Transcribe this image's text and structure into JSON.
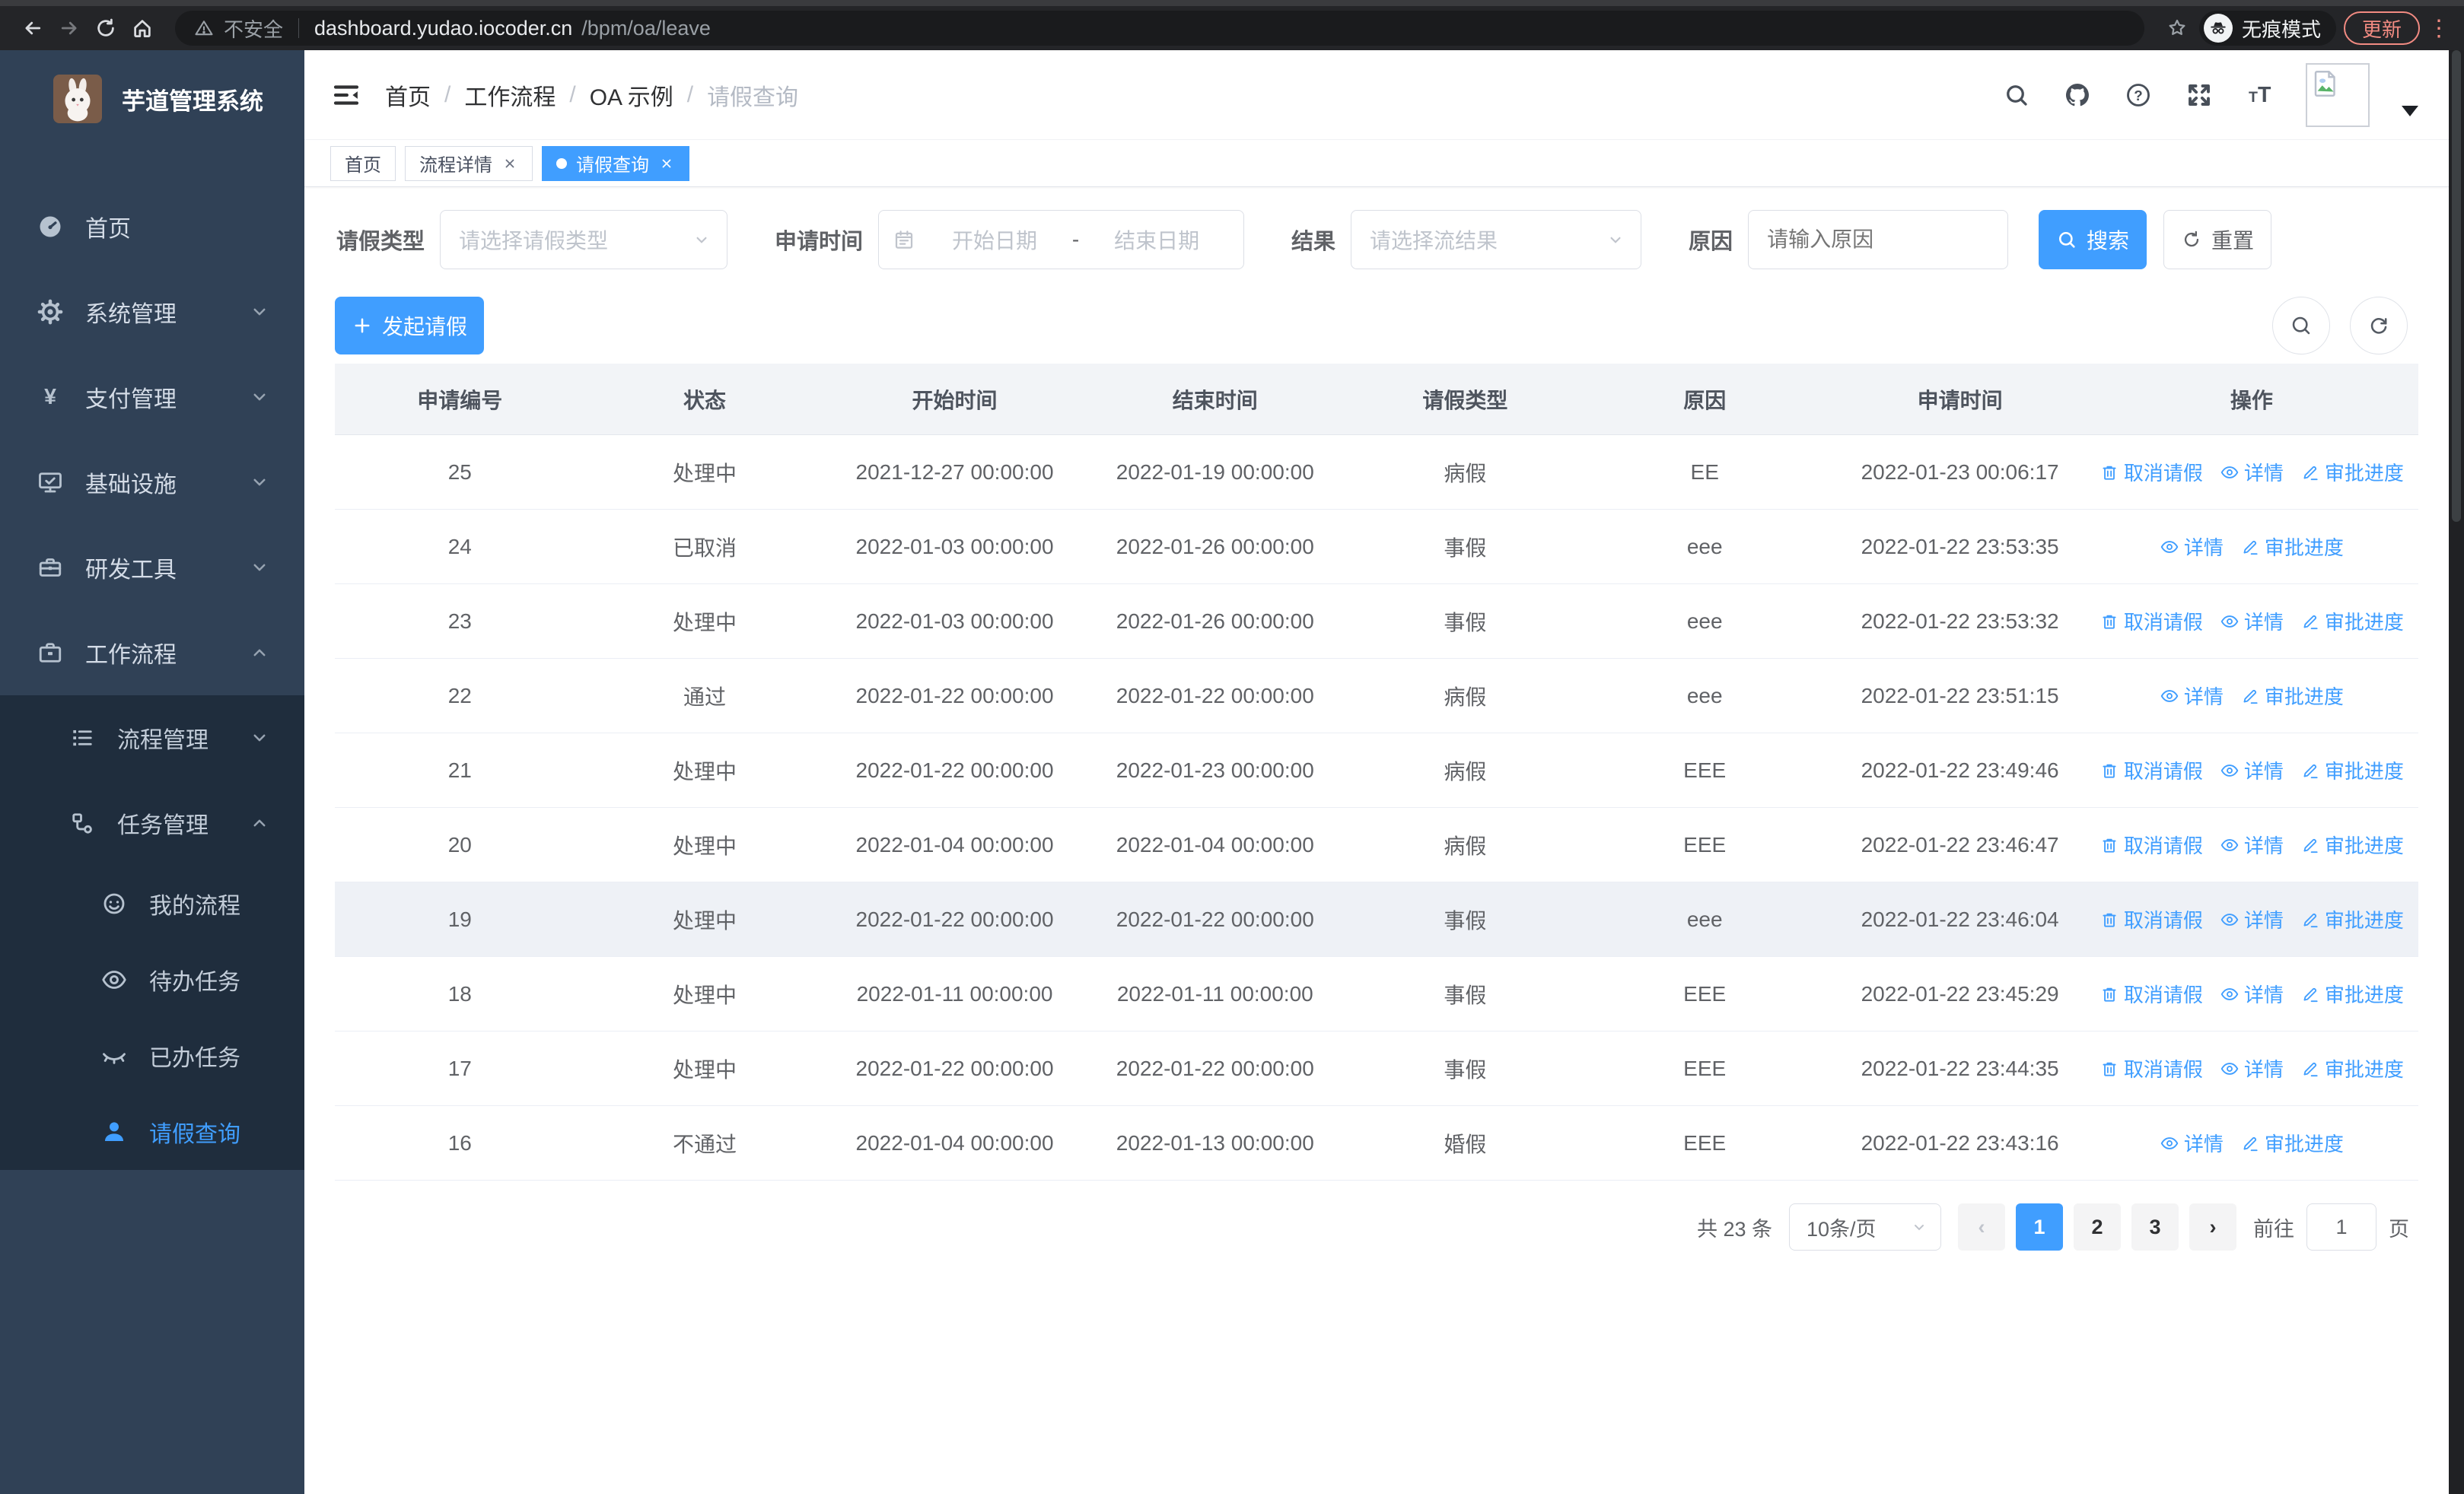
{
  "browser": {
    "security_label": "不安全",
    "url_host": "dashboard.yudao.iocoder.cn",
    "url_path": "/bpm/oa/leave",
    "incognito_label": "无痕模式",
    "update_label": "更新"
  },
  "sidebar": {
    "logo_title": "芋道管理系统",
    "menu": [
      {
        "key": "home",
        "label": "首页",
        "icon": "gauge-icon",
        "level": 1
      },
      {
        "key": "system",
        "label": "系统管理",
        "icon": "gear-icon",
        "level": 1,
        "chevron": "down"
      },
      {
        "key": "payment",
        "label": "支付管理",
        "icon": "yen-icon",
        "level": 1,
        "chevron": "down"
      },
      {
        "key": "infrastructure",
        "label": "基础设施",
        "icon": "monitor-icon",
        "level": 1,
        "chevron": "down"
      },
      {
        "key": "dev-tools",
        "label": "研发工具",
        "icon": "toolbox-icon",
        "level": 1,
        "chevron": "down"
      },
      {
        "key": "workflow",
        "label": "工作流程",
        "icon": "briefcase-icon",
        "level": 1,
        "chevron": "up"
      },
      {
        "key": "process-mgmt",
        "label": "流程管理",
        "icon": "flow-icon",
        "level": 2,
        "submenu": true,
        "chevron": "down"
      },
      {
        "key": "task-mgmt",
        "label": "任务管理",
        "icon": "tasks-icon",
        "level": 2,
        "submenu": true,
        "chevron": "up"
      },
      {
        "key": "my-process",
        "label": "我的流程",
        "icon": "face-icon",
        "level": 3,
        "submenu": true
      },
      {
        "key": "todo-tasks",
        "label": "待办任务",
        "icon": "eye-icon",
        "level": 3,
        "submenu": true
      },
      {
        "key": "done-tasks",
        "label": "已办任务",
        "icon": "eye-closed-icon",
        "level": 3,
        "submenu": true
      },
      {
        "key": "leave-query",
        "label": "请假查询",
        "icon": "user-icon",
        "level": 3,
        "submenu": true,
        "active": true
      }
    ]
  },
  "header": {
    "breadcrumb": [
      "首页",
      "工作流程",
      "OA 示例",
      "请假查询"
    ]
  },
  "tabs": [
    {
      "key": "home",
      "label": "首页",
      "closable": false,
      "active": false
    },
    {
      "key": "process-detail",
      "label": "流程详情",
      "closable": true,
      "active": false
    },
    {
      "key": "leave-query",
      "label": "请假查询",
      "closable": true,
      "active": true
    }
  ],
  "filters": {
    "leave_type": {
      "label": "请假类型",
      "placeholder": "请选择请假类型"
    },
    "apply_time": {
      "label": "申请时间",
      "start_placeholder": "开始日期",
      "separator": "-",
      "end_placeholder": "结束日期"
    },
    "result": {
      "label": "结果",
      "placeholder": "请选择流结果"
    },
    "reason": {
      "label": "原因",
      "placeholder": "请输入原因"
    },
    "search_label": "搜索",
    "reset_label": "重置"
  },
  "toolbar": {
    "create_label": "发起请假"
  },
  "table": {
    "headers": [
      "申请编号",
      "状态",
      "开始时间",
      "结束时间",
      "请假类型",
      "原因",
      "申请时间",
      "操作"
    ],
    "action_labels": {
      "cancel": "取消请假",
      "detail": "详情",
      "progress": "审批进度"
    },
    "rows": [
      {
        "id": "25",
        "status": "处理中",
        "start": "2021-12-27 00:00:00",
        "end": "2022-01-19 00:00:00",
        "type": "病假",
        "reason": "EE",
        "apply": "2022-01-23 00:06:17",
        "actions": [
          "cancel",
          "detail",
          "progress"
        ],
        "highlight": false
      },
      {
        "id": "24",
        "status": "已取消",
        "start": "2022-01-03 00:00:00",
        "end": "2022-01-26 00:00:00",
        "type": "事假",
        "reason": "eee",
        "apply": "2022-01-22 23:53:35",
        "actions": [
          "detail",
          "progress"
        ],
        "highlight": false
      },
      {
        "id": "23",
        "status": "处理中",
        "start": "2022-01-03 00:00:00",
        "end": "2022-01-26 00:00:00",
        "type": "事假",
        "reason": "eee",
        "apply": "2022-01-22 23:53:32",
        "actions": [
          "cancel",
          "detail",
          "progress"
        ],
        "highlight": false
      },
      {
        "id": "22",
        "status": "通过",
        "start": "2022-01-22 00:00:00",
        "end": "2022-01-22 00:00:00",
        "type": "病假",
        "reason": "eee",
        "apply": "2022-01-22 23:51:15",
        "actions": [
          "detail",
          "progress"
        ],
        "highlight": false
      },
      {
        "id": "21",
        "status": "处理中",
        "start": "2022-01-22 00:00:00",
        "end": "2022-01-23 00:00:00",
        "type": "病假",
        "reason": "EEE",
        "apply": "2022-01-22 23:49:46",
        "actions": [
          "cancel",
          "detail",
          "progress"
        ],
        "highlight": false
      },
      {
        "id": "20",
        "status": "处理中",
        "start": "2022-01-04 00:00:00",
        "end": "2022-01-04 00:00:00",
        "type": "病假",
        "reason": "EEE",
        "apply": "2022-01-22 23:46:47",
        "actions": [
          "cancel",
          "detail",
          "progress"
        ],
        "highlight": false
      },
      {
        "id": "19",
        "status": "处理中",
        "start": "2022-01-22 00:00:00",
        "end": "2022-01-22 00:00:00",
        "type": "事假",
        "reason": "eee",
        "apply": "2022-01-22 23:46:04",
        "actions": [
          "cancel",
          "detail",
          "progress"
        ],
        "highlight": true
      },
      {
        "id": "18",
        "status": "处理中",
        "start": "2022-01-11 00:00:00",
        "end": "2022-01-11 00:00:00",
        "type": "事假",
        "reason": "EEE",
        "apply": "2022-01-22 23:45:29",
        "actions": [
          "cancel",
          "detail",
          "progress"
        ],
        "highlight": false
      },
      {
        "id": "17",
        "status": "处理中",
        "start": "2022-01-22 00:00:00",
        "end": "2022-01-22 00:00:00",
        "type": "事假",
        "reason": "EEE",
        "apply": "2022-01-22 23:44:35",
        "actions": [
          "cancel",
          "detail",
          "progress"
        ],
        "highlight": false
      },
      {
        "id": "16",
        "status": "不通过",
        "start": "2022-01-04 00:00:00",
        "end": "2022-01-13 00:00:00",
        "type": "婚假",
        "reason": "EEE",
        "apply": "2022-01-22 23:43:16",
        "actions": [
          "detail",
          "progress"
        ],
        "highlight": false
      }
    ]
  },
  "pagination": {
    "total_label": "共 23 条",
    "page_size_label": "10条/页",
    "prev_glyph": "‹",
    "next_glyph": "›",
    "pages": [
      "1",
      "2",
      "3"
    ],
    "active_page": "1",
    "jump_prefix": "前往",
    "jump_value": "1",
    "jump_suffix": "页"
  },
  "colors": {
    "accent": "#409eff",
    "sidebar_bg": "#304156",
    "submenu_bg": "#1f2d3d"
  }
}
